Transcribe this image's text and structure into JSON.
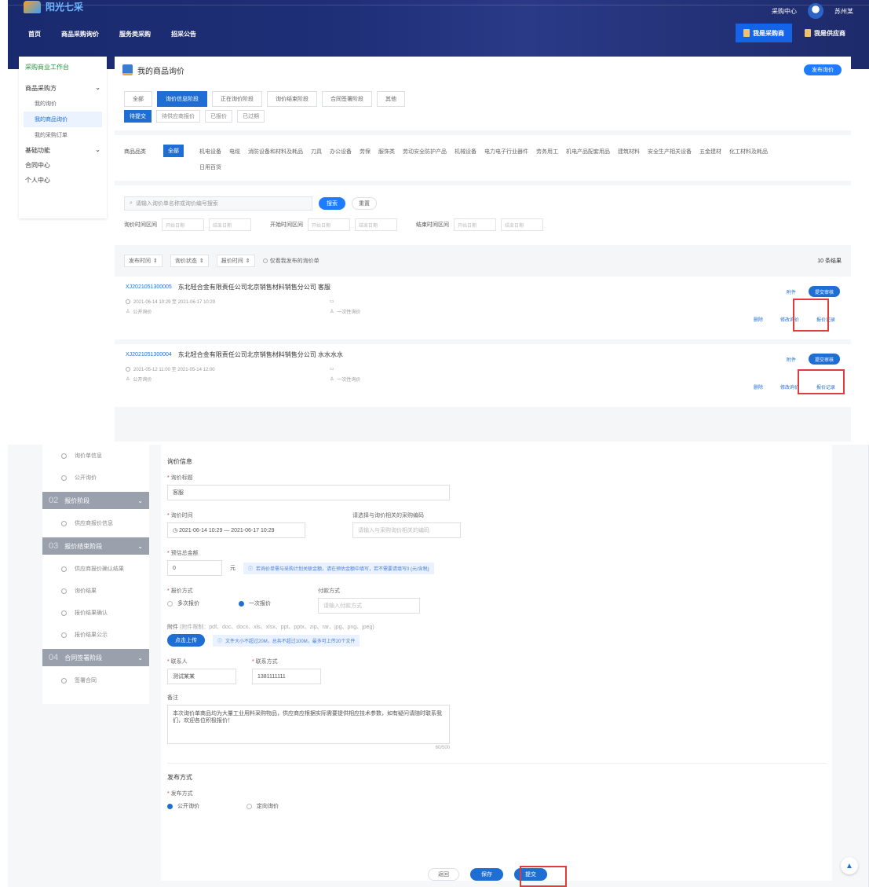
{
  "header": {
    "logo_text": "阳光七采",
    "top_links": [
      "采购中心",
      "苏州某"
    ],
    "nav": [
      "首页",
      "商品采购询价",
      "服务类采购",
      "招采公告"
    ],
    "actions": [
      {
        "label": "我是采购商",
        "active": true
      },
      {
        "label": "我是供应商",
        "active": false
      }
    ]
  },
  "sidebar": {
    "title": "采购商业工作台",
    "items": [
      {
        "label": "商品采购方",
        "expand": "⌄"
      },
      {
        "label": "我的询价",
        "sub": true,
        "active": false
      },
      {
        "label": "我的商品询价",
        "sub": true,
        "active": true
      },
      {
        "label": "我的采购订单",
        "sub": true,
        "active": false
      },
      {
        "label": "基础功能",
        "expand": "⌄"
      },
      {
        "label": "合同中心"
      },
      {
        "label": "个人中心"
      }
    ]
  },
  "main": {
    "title": "我的商品询价",
    "create_btn": "发布询价",
    "tabs": [
      "全部",
      "询价信息阶段",
      "正在询价阶段",
      "询价结束阶段",
      "合同签署阶段",
      "其他"
    ],
    "subtabs": [
      "待提交",
      "待供应商报价",
      "已报价",
      "已过期"
    ],
    "category_label": "商品品类",
    "category_all": "全部",
    "categories": [
      "机电设备",
      "电缆",
      "消防设备和材料及耗品",
      "刀具",
      "办公设备",
      "劳保",
      "服饰类",
      "劳动安全防护产品",
      "机械设备",
      "电力电子行业器件",
      "劳务用工",
      "机电产品配套用品",
      "建筑材料",
      "安全生产相关设备",
      "五金建材",
      "化工材料及耗品",
      "日用百货"
    ],
    "search_placeholder": "请输入询价单名称或询价编号搜索",
    "search_btn": "搜索",
    "reset_btn": "重置",
    "date_filters": [
      "询价时间区间",
      "开始时间区间",
      "结束时间区间"
    ],
    "date_placeholder_start": "开始日期",
    "date_placeholder_end": "结束日期",
    "sort": [
      "发布时间",
      "询价状态",
      "报价时间"
    ],
    "sort_check": "仅看我发布的询价单",
    "result_count": "10 条结果",
    "records": [
      {
        "id": "XJ2021051300005",
        "title": "东北轻合金有限责任公司北京销售材料销售分公司 客服",
        "time": "2021-06-14 10:29 至 2021-06-17 10:29",
        "mode": "公开询价",
        "type": "一次性询价",
        "link": "附件",
        "submit": "提交审核",
        "actions": [
          "删除",
          "修改询价",
          "报价记录"
        ]
      },
      {
        "id": "XJ2021051300004",
        "title": "东北轻合金有限责任公司北京销售材料销售分公司 水水水水",
        "time": "2021-05-12 11:00 至 2021-05-14 12:00",
        "mode": "公开询价",
        "type": "一次性询价",
        "link": "附件",
        "submit": "提交审核",
        "actions": [
          "删除",
          "修改询价",
          "报价记录"
        ]
      }
    ]
  },
  "steps": {
    "top_subs": [
      "询价单信息",
      "公开询价"
    ],
    "groups": [
      {
        "num": "02",
        "label": "报价阶段",
        "subs": [
          "供应商报价信息"
        ]
      },
      {
        "num": "03",
        "label": "报价结束阶段",
        "subs": [
          "供应商报价确认结果",
          "询价结果",
          "报价结果确认",
          "报价结果公示"
        ]
      },
      {
        "num": "04",
        "label": "合同签署阶段",
        "subs": [
          "签署合同"
        ]
      }
    ]
  },
  "form": {
    "section1": "询价信息",
    "title_label": "询价标题",
    "title_value": "客服",
    "time_label": "询价时间",
    "time_value": "2021-06-14 10:29 — 2021-06-17 10:29",
    "related_label": "请选择与询价相关的采购编码",
    "related_placeholder": "请输入与采购询价相关的编码",
    "amount_label": "预估总金额",
    "amount_value": "0",
    "amount_unit": "元",
    "amount_tip": "若询价单需与采购计划关联金额，请在预估金额中填写，若不需要请填写0 (元/含税)",
    "quote_label": "报价方式",
    "quote_options": [
      "多次报价",
      "一次报价"
    ],
    "pay_label": "付款方式",
    "pay_placeholder": "请输入付款方式",
    "attach_label": "附件",
    "attach_hint": "(附件限制：pdf、doc、docx、xls、xlsx、ppt、pptx、zip、rar、jpg、png、jpeg)",
    "upload_btn": "点击上传",
    "upload_tip": "文件大小不超过20M，总共不超过100M，最多可上传20个文件",
    "contact_label": "联系人",
    "contact_value": "测试某某",
    "phone_label": "联系方式",
    "phone_value": "1381111111",
    "note_label": "备注",
    "note_value": "本次询价单商品均为大量工业用料采购物品，供应商应根据实际需要提供相应技术参数，如有疑问请随时联系我们，欢迎各位积极报价！",
    "note_counter": "60/500",
    "section2": "发布方式",
    "publish_label": "发布方式",
    "publish_options": [
      "公开询价",
      "定向询价"
    ],
    "btn_back": "返回",
    "btn_save": "保存",
    "btn_submit": "提交"
  },
  "colors": {
    "primary": "#1f6ed4",
    "header": "#1f2f78",
    "highlight": "#e23b3b"
  }
}
